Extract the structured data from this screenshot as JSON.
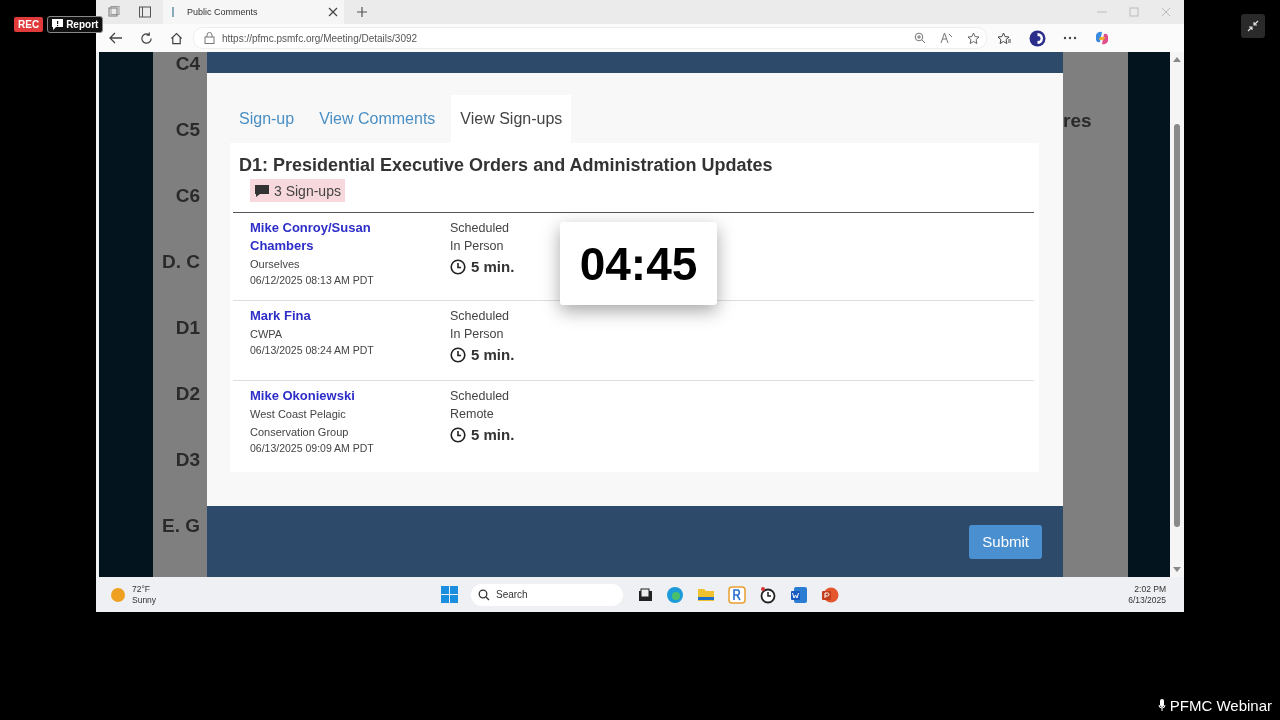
{
  "recording": {
    "badge": "REC",
    "report_button": "Report"
  },
  "browser": {
    "tab": {
      "title": "Public Comments"
    },
    "address": "https://pfmc.psmfc.org/Meeting/Details/3092"
  },
  "background_page": {
    "left_labels": [
      "C4",
      "C5",
      "C6",
      "D. C",
      "D1",
      "D2",
      "D3",
      "E. G"
    ],
    "right_label": "res"
  },
  "modal": {
    "tabs": [
      {
        "label": "Sign-up",
        "selected": false
      },
      {
        "label": "View Comments",
        "selected": false
      },
      {
        "label": "View Sign-ups",
        "selected": true
      }
    ],
    "title": "D1: Presidential Executive Orders and Administration Updates",
    "signup_count": "3 Sign-ups",
    "signups": [
      {
        "name": "Mike Conroy/Susan Chambers",
        "organization": "Ourselves",
        "timestamp": "06/12/2025 08:13 AM PDT",
        "status": "Scheduled",
        "mode": "In Person",
        "duration": "5 min."
      },
      {
        "name": "Mark Fina",
        "organization": "CWPA",
        "timestamp": "06/13/2025 08:24 AM PDT",
        "status": "Scheduled",
        "mode": "In Person",
        "duration": "5 min."
      },
      {
        "name": "Mike Okoniewski",
        "organization": "West Coast Pelagic Conservation Group",
        "timestamp": "06/13/2025 09:09 AM PDT",
        "status": "Scheduled",
        "mode": "Remote",
        "duration": "5 min."
      }
    ],
    "submit_button": "Submit"
  },
  "timer": "04:45",
  "taskbar": {
    "weather": {
      "temperature": "72°F",
      "condition": "Sunny"
    },
    "search": {
      "placeholder": "Search"
    },
    "clock": {
      "time": "2:02 PM",
      "date": "6/13/2025"
    }
  },
  "webinar_label": "PFMC Webinar"
}
